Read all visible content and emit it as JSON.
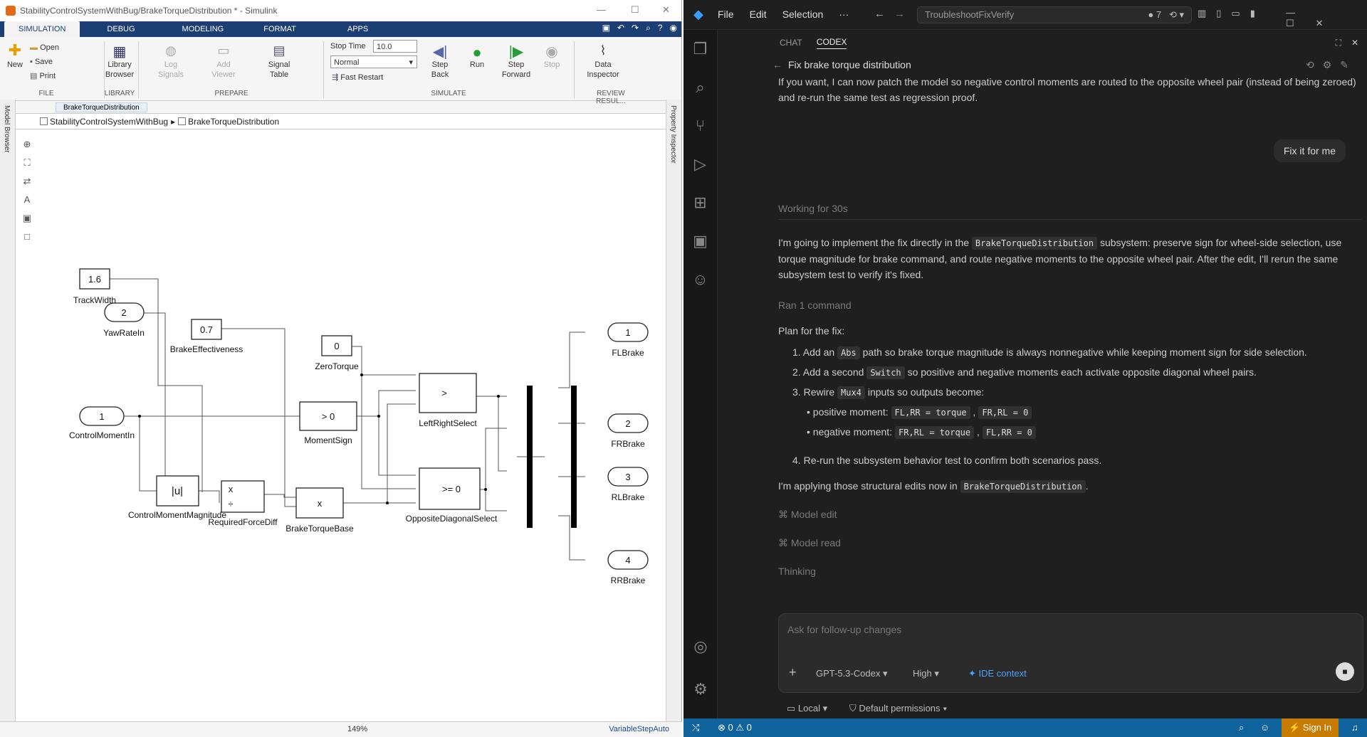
{
  "simulink": {
    "title": "StabilityControlSystemWithBug/BrakeTorqueDistribution * - Simulink",
    "tabs": [
      "SIMULATION",
      "DEBUG",
      "MODELING",
      "FORMAT",
      "APPS"
    ],
    "ribbon": {
      "new": "New",
      "open": "Open",
      "save": "Save",
      "print": "Print",
      "library_browser": "Library\nBrowser",
      "log_signals": "Log\nSignals",
      "add_viewer": "Add\nViewer",
      "signal_table": "Signal\nTable",
      "stop_time_label": "Stop Time",
      "stop_time_value": "10.0",
      "mode": "Normal",
      "fast_restart": "Fast Restart",
      "step_back": "Step\nBack",
      "run": "Run",
      "step_forward": "Step\nForward",
      "stop": "Stop",
      "data_inspector": "Data\nInspector",
      "sections": {
        "file": "FILE",
        "library": "LIBRARY",
        "prepare": "PREPARE",
        "simulate": "SIMULATE",
        "review": "REVIEW RESUL..."
      }
    },
    "address_tab": "BrakeTorqueDistribution",
    "breadcrumb": [
      "StabilityControlSystemWithBug",
      "BrakeTorqueDistribution"
    ],
    "left_label": "Model Browser",
    "right_label": "Property Inspector",
    "zoom": "149%",
    "solver": "VariableStepAuto",
    "blocks": {
      "trackwidth_value": "1.6",
      "trackwidth": "TrackWidth",
      "yawrate_port": "2",
      "yawrate": "YawRateIn",
      "brakeeff_value": "0.7",
      "brakeeff": "BrakeEffectiveness",
      "zero_value": "0",
      "zero": "ZeroTorque",
      "control_port": "1",
      "control": "ControlMomentIn",
      "momentsign_op": "> 0",
      "momentsign": "MomentSign",
      "leftright_op": ">",
      "leftright": "LeftRightSelect",
      "abs_op": "|u|",
      "abs": "ControlMomentMagnitude",
      "req_op1": "x",
      "req_op2": "÷",
      "req": "RequiredForceDiff",
      "btb_op": "x",
      "btb": "BrakeTorqueBase",
      "opp_op": ">= 0",
      "opp": "OppositeDiagonalSelect",
      "out1": "1",
      "fl": "FLBrake",
      "out2": "2",
      "fr": "FRBrake",
      "out3": "3",
      "rl": "RLBrake",
      "out4": "4",
      "rr": "RRBrake"
    }
  },
  "vscode": {
    "menu": [
      "File",
      "Edit",
      "Selection",
      "···"
    ],
    "search": "TroubleshootFixVerify",
    "badge": "7",
    "panel_tabs": [
      "CHAT",
      "CODEX"
    ],
    "thread_title": "Fix brake torque distribution",
    "top_text": "If you want, I can now patch the model so negative control moments are routed to the opposite wheel pair (instead of being zeroed) and re-run the same test as regression proof.",
    "user_msg": "Fix it for me",
    "working": "Working for 30s",
    "reply_a": "I'm going to implement the fix directly in the",
    "reply_code": "BrakeTorqueDistribution",
    "reply_b": "subsystem: preserve sign for wheel-side selection, use torque magnitude for brake command, and route negative moments to the opposite wheel pair. After the edit, I'll rerun the same subsystem test to verify it's fixed.",
    "ran": "Ran 1 command",
    "plan_title": "Plan for the fix:",
    "p1a": "Add an",
    "p1c": "Abs",
    "p1b": "path so brake torque magnitude is always nonnegative while keeping moment sign for side selection.",
    "p2a": "Add a second",
    "p2c": "Switch",
    "p2b": "so positive and negative moments each activate opposite diagonal wheel pairs.",
    "p3a": "Rewire",
    "p3c": "Mux4",
    "p3b": "inputs so outputs become:",
    "b1": "positive moment:",
    "b1c1": "FL,RR = torque",
    "b1c2": "FR,RL = 0",
    "b2": "negative moment:",
    "b2c1": "FR,RL = torque",
    "b2c2": "FL,RR = 0",
    "p4": "Re-run the subsystem behavior test to confirm both scenarios pass.",
    "applying_a": "I'm applying those structural edits now in",
    "applying_c": "BrakeTorqueDistribution",
    "applying_b": ".",
    "model_edit": "Model edit",
    "model_read": "Model read",
    "thinking": "Thinking",
    "input_placeholder": "Ask for follow-up changes",
    "model": "GPT-5.3-Codex",
    "effort": "High",
    "ide_context": "IDE context",
    "local": "Local",
    "permissions": "Default permissions",
    "status_errors": "0",
    "status_warnings": "0",
    "sign_in": "Sign In"
  }
}
